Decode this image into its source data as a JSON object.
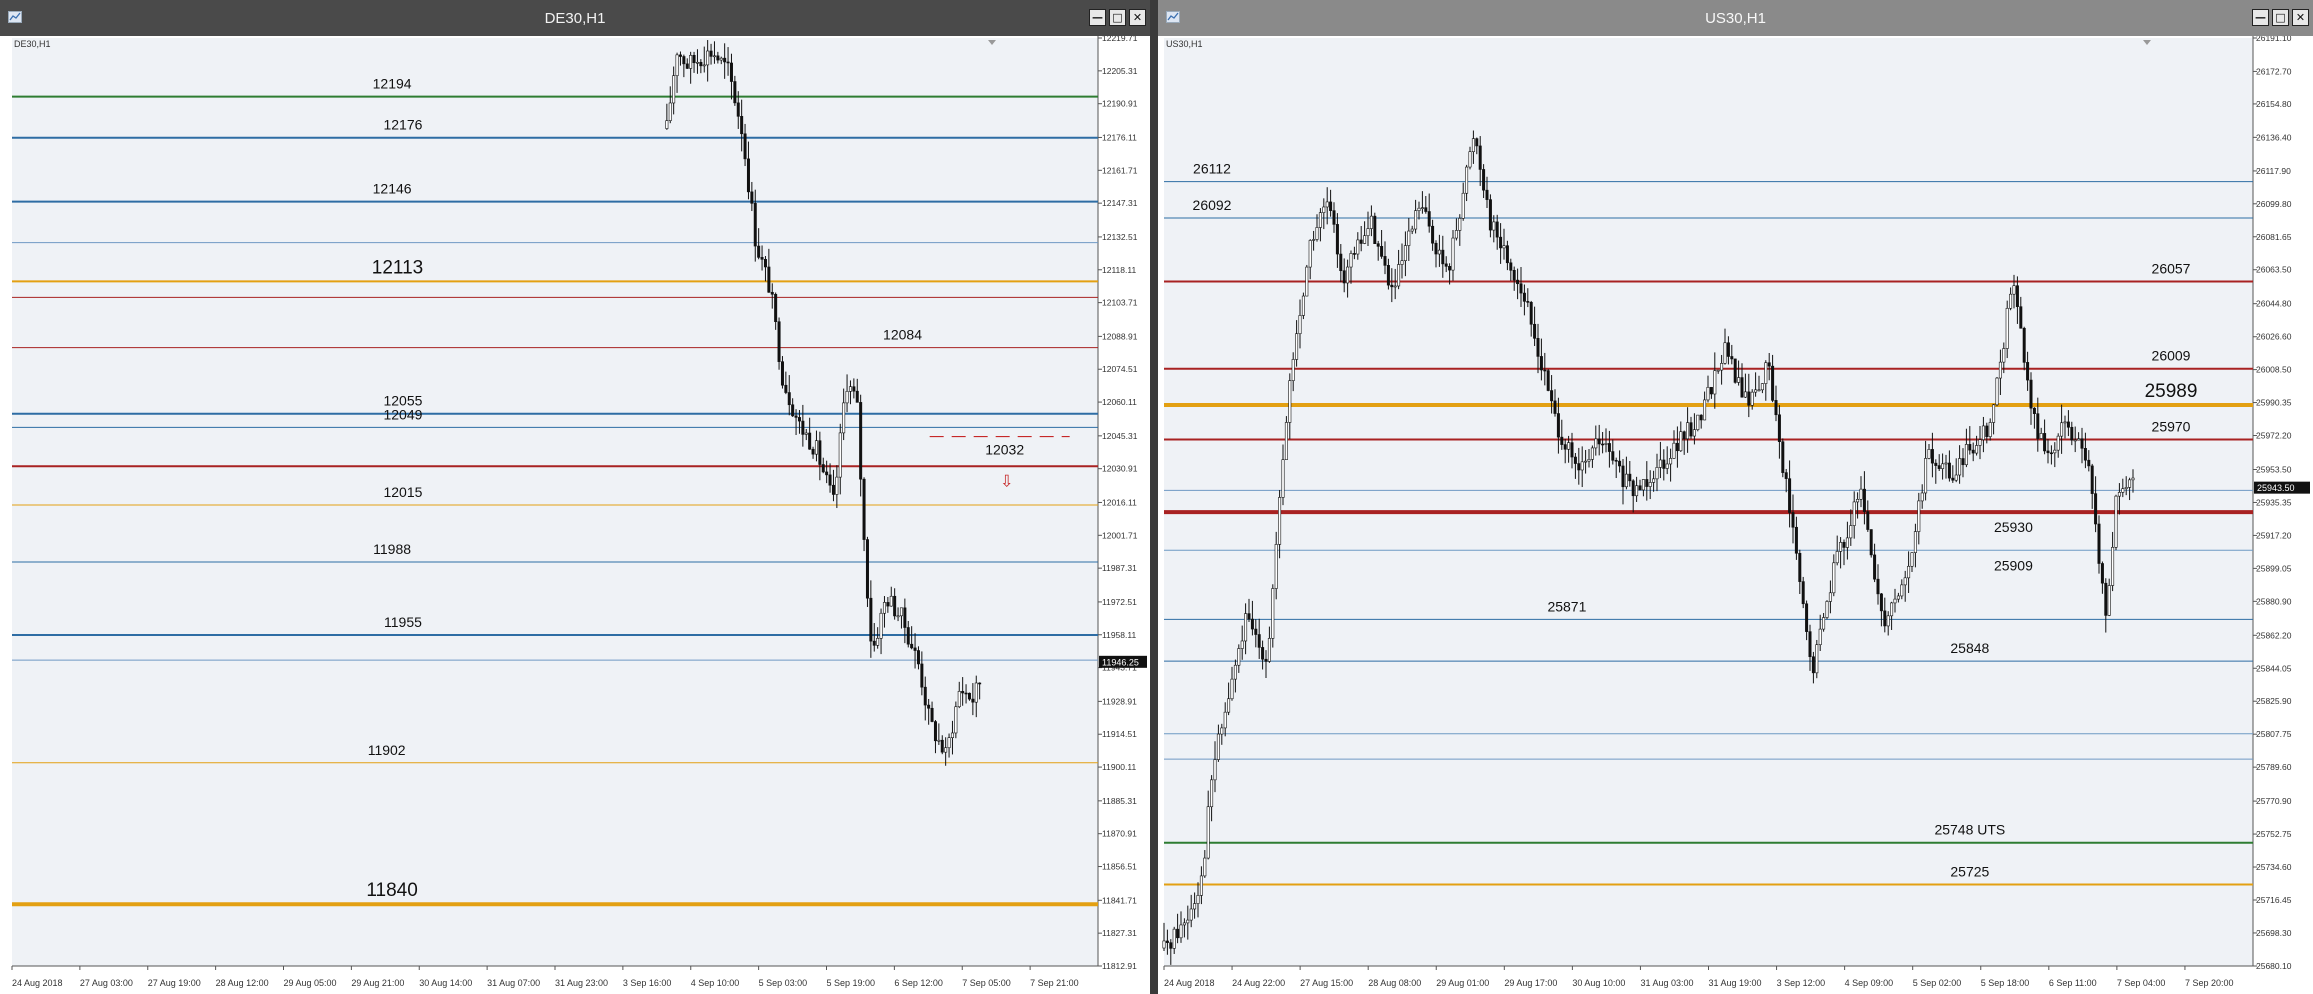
{
  "windows": [
    {
      "title": "DE30,H1",
      "close_glyph": "✕",
      "maximize_glyph": "□",
      "minimize_glyph": "—",
      "icon": "chart-window-icon"
    },
    {
      "title": "US30,H1",
      "close_glyph": "✕",
      "maximize_glyph": "□",
      "minimize_glyph": "—",
      "icon": "chart-window-icon"
    }
  ],
  "colors": {
    "chart_bg": "#eff2f6",
    "green": "#2e7d32",
    "blue": "#2e6da4",
    "orange": "#e3a012",
    "red": "#a82222",
    "thin_blue": "#6f99c4",
    "candle": "#111111"
  },
  "chart_data": [
    {
      "type": "candlestick",
      "symbol_label": "DE30,H1",
      "ylim": [
        11812.91,
        12219.71
      ],
      "y_ticks": [
        "12219.71",
        "12205.31",
        "12190.91",
        "12176.11",
        "12161.71",
        "12147.31",
        "12132.51",
        "12118.11",
        "12103.71",
        "12088.91",
        "12074.51",
        "12060.11",
        "12045.31",
        "12030.91",
        "12016.11",
        "12001.71",
        "11987.31",
        "11972.51",
        "11958.11",
        "11943.71",
        "11928.91",
        "11914.51",
        "11900.11",
        "11885.31",
        "11870.91",
        "11856.51",
        "11841.71",
        "11827.31",
        "11812.91"
      ],
      "current_price": "11946.25",
      "x_ticks": [
        "24 Aug 2018",
        "27 Aug 03:00",
        "27 Aug 19:00",
        "28 Aug 12:00",
        "29 Aug 05:00",
        "29 Aug 21:00",
        "30 Aug 14:00",
        "31 Aug 07:00",
        "31 Aug 23:00",
        "3 Sep 16:00",
        "4 Sep 10:00",
        "5 Sep 03:00",
        "5 Sep 19:00",
        "6 Sep 12:00",
        "7 Sep 05:00",
        "7 Sep 21:00"
      ],
      "levels": [
        {
          "price": 12194,
          "label": "12194",
          "color": "green",
          "width": 2
        },
        {
          "price": 12176,
          "label": "12176",
          "color": "blue",
          "width": 2
        },
        {
          "price": 12148,
          "label": "12146",
          "color": "blue",
          "width": 2
        },
        {
          "price": 12130,
          "label": "",
          "color": "thin_blue",
          "width": 1
        },
        {
          "price": 12113,
          "label": "12113",
          "color": "orange",
          "width": 2,
          "big": true
        },
        {
          "price": 12106,
          "label": "",
          "color": "red",
          "width": 1
        },
        {
          "price": 12084,
          "label": "12084",
          "color": "red",
          "width": 1
        },
        {
          "price": 12055,
          "label": "12055",
          "color": "blue",
          "width": 2
        },
        {
          "price": 12049,
          "label": "12049",
          "color": "blue",
          "width": 1
        },
        {
          "price": 12032,
          "label": "",
          "color": "red",
          "width": 2
        },
        {
          "price": 12015,
          "label": "12015",
          "color": "orange",
          "width": 1
        },
        {
          "price": 11990,
          "label": "11988",
          "color": "blue",
          "width": 1
        },
        {
          "price": 11958,
          "label": "11955",
          "color": "blue",
          "width": 2
        },
        {
          "price": 11947,
          "label": "",
          "color": "thin_blue",
          "width": 1
        },
        {
          "price": 11902,
          "label": "11902",
          "color": "orange",
          "width": 1
        },
        {
          "price": 11840,
          "label": "11840",
          "color": "orange",
          "width": 4,
          "big": true
        }
      ],
      "annotation": {
        "label": "12032",
        "arrow": "⇩"
      }
    },
    {
      "type": "candlestick",
      "symbol_label": "US30,H1",
      "ylim": [
        25680.1,
        26191.1
      ],
      "y_ticks": [
        "26191.10",
        "26172.70",
        "26154.80",
        "26136.40",
        "26117.90",
        "26099.80",
        "26081.65",
        "26063.50",
        "26044.80",
        "26026.60",
        "26008.50",
        "25990.35",
        "25972.20",
        "25953.50",
        "25935.35",
        "25917.20",
        "25899.05",
        "25880.90",
        "25862.20",
        "25844.05",
        "25825.90",
        "25807.75",
        "25789.60",
        "25770.90",
        "25752.75",
        "25734.60",
        "25716.45",
        "25698.30",
        "25680.10"
      ],
      "current_price": "25943.50",
      "x_ticks": [
        "24 Aug 2018",
        "24 Aug 22:00",
        "27 Aug 15:00",
        "28 Aug 08:00",
        "29 Aug 01:00",
        "29 Aug 17:00",
        "30 Aug 10:00",
        "31 Aug 03:00",
        "31 Aug 19:00",
        "3 Sep 12:00",
        "4 Sep 09:00",
        "5 Sep 02:00",
        "5 Sep 18:00",
        "6 Sep 11:00",
        "7 Sep 04:00",
        "7 Sep 20:00"
      ],
      "levels": [
        {
          "price": 26112,
          "label": "26112",
          "color": "blue",
          "width": 1,
          "label_side": "left"
        },
        {
          "price": 26092,
          "label": "26092",
          "color": "blue",
          "width": 1,
          "label_side": "left"
        },
        {
          "price": 26057,
          "label": "26057",
          "color": "red",
          "width": 2,
          "label_side": "right"
        },
        {
          "price": 26009,
          "label": "26009",
          "color": "red",
          "width": 2,
          "label_side": "right"
        },
        {
          "price": 25989,
          "label": "25989",
          "color": "orange",
          "width": 4,
          "label_side": "right",
          "big": true
        },
        {
          "price": 25970,
          "label": "25970",
          "color": "red",
          "width": 2,
          "label_side": "right"
        },
        {
          "price": 25942,
          "label": "",
          "color": "thin_blue",
          "width": 1
        },
        {
          "price": 25930,
          "label": "25930",
          "color": "red",
          "width": 4,
          "label_side": "mid"
        },
        {
          "price": 25909,
          "label": "25909",
          "color": "thin_blue",
          "width": 1,
          "label_side": "mid"
        },
        {
          "price": 25871,
          "label": "25871",
          "color": "blue",
          "width": 1,
          "label_side": "leftmid"
        },
        {
          "price": 25848,
          "label": "25848",
          "color": "blue",
          "width": 1,
          "label_side": "center"
        },
        {
          "price": 25808,
          "label": "",
          "color": "thin_blue",
          "width": 1
        },
        {
          "price": 25794,
          "label": "",
          "color": "thin_blue",
          "width": 1
        },
        {
          "price": 25748,
          "label": "25748 UTS",
          "color": "green",
          "width": 2,
          "label_side": "center"
        },
        {
          "price": 25725,
          "label": "25725",
          "color": "orange",
          "width": 2,
          "label_side": "center"
        }
      ]
    }
  ]
}
